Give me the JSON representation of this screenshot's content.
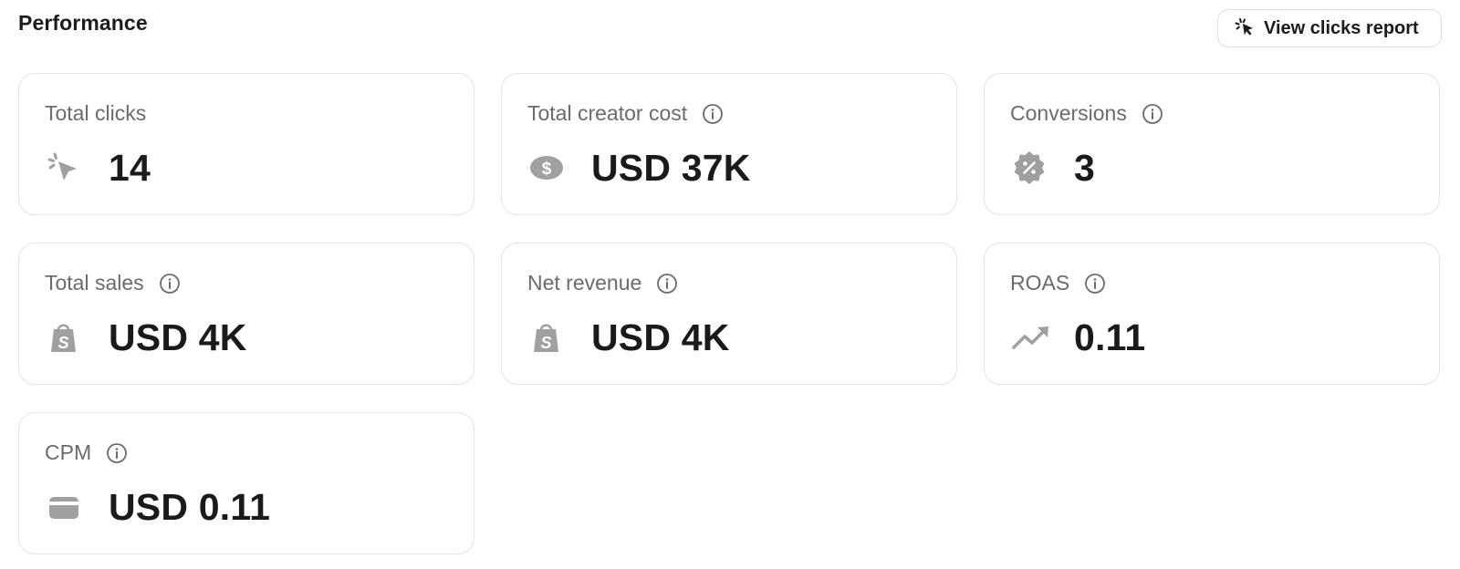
{
  "header": {
    "title": "Performance",
    "report_button_label": "View clicks report"
  },
  "cards": [
    {
      "label": "Total clicks",
      "value": "14",
      "icon": "cursor-click-icon",
      "has_info": false
    },
    {
      "label": "Total creator cost",
      "value": "USD 37K",
      "icon": "dollar-eye-icon",
      "has_info": true
    },
    {
      "label": "Conversions",
      "value": "3",
      "icon": "discount-badge-icon",
      "has_info": true
    },
    {
      "label": "Total sales",
      "value": "USD 4K",
      "icon": "shopify-bag-icon",
      "has_info": true
    },
    {
      "label": "Net revenue",
      "value": "USD 4K",
      "icon": "shopify-bag-icon",
      "has_info": true
    },
    {
      "label": "ROAS",
      "value": "0.11",
      "icon": "trending-up-icon",
      "has_info": true
    },
    {
      "label": "CPM",
      "value": "USD 0.11",
      "icon": "credit-card-icon",
      "has_info": true
    }
  ],
  "colors": {
    "icon_gray": "#a0a0a0",
    "label_gray": "#6b6b6b",
    "value_text": "#1a1a1a",
    "card_border": "#e3e3e3"
  }
}
